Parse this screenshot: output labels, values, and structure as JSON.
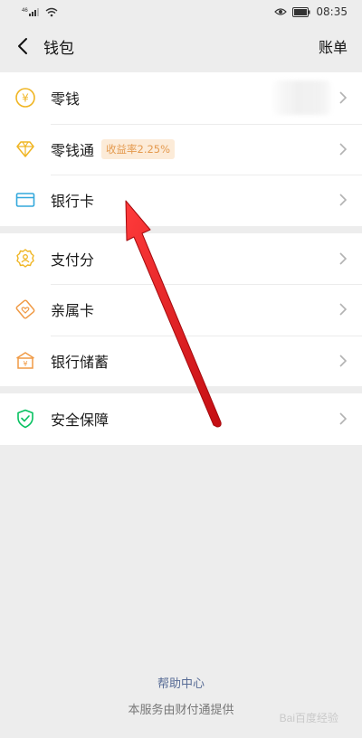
{
  "status_bar": {
    "signal": "⁴⁶",
    "time": "08:35",
    "icons": [
      "signal-icon",
      "wifi-icon",
      "eye-icon",
      "battery-icon"
    ]
  },
  "nav": {
    "back_icon": "chevron-left-icon",
    "title": "钱包",
    "right_label": "账单"
  },
  "groups": [
    {
      "items": [
        {
          "label": "零钱",
          "icon": "yuan-coin-icon",
          "icon_color": "#f0b522"
        },
        {
          "label": "零钱通",
          "icon": "diamond-icon",
          "icon_color": "#f0b522",
          "badge": "收益率2.25%"
        },
        {
          "label": "银行卡",
          "icon": "bank-card-icon",
          "icon_color": "#33a8dc"
        }
      ]
    },
    {
      "items": [
        {
          "label": "支付分",
          "icon": "badge-icon",
          "icon_color": "#f0b522"
        },
        {
          "label": "亲属卡",
          "icon": "heart-card-icon",
          "icon_color": "#f09a45"
        },
        {
          "label": "银行储蓄",
          "icon": "bank-savings-icon",
          "icon_color": "#f09a45"
        }
      ]
    },
    {
      "items": [
        {
          "label": "安全保障",
          "icon": "shield-check-icon",
          "icon_color": "#07c160"
        }
      ]
    }
  ],
  "footer": {
    "help_link": "帮助中心",
    "service_text": "本服务由财付通提供"
  },
  "watermark": "Bai百度经验",
  "colors": {
    "background": "#ededed",
    "link": "#576b95",
    "arrow": "#e8171b"
  }
}
